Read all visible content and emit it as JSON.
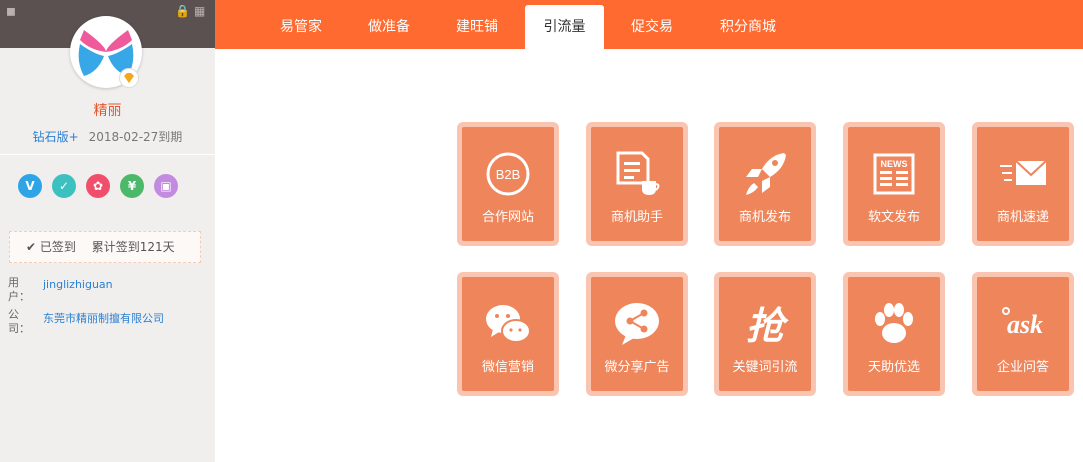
{
  "sidebar": {
    "username": "精丽",
    "vip_version": "钻石版+",
    "expiry": "2018-02-27到期",
    "services": [
      {
        "icon": "verified-v-icon",
        "glyph": "V",
        "color": "#2ea4e7"
      },
      {
        "icon": "shield-check-icon",
        "glyph": "✓",
        "color": "#3cc0c0"
      },
      {
        "icon": "award-ribbon-icon",
        "glyph": "✿",
        "color": "#f04e6b"
      },
      {
        "icon": "yuan-coin-icon",
        "glyph": "¥",
        "color": "#4cb86a"
      },
      {
        "icon": "image-icon",
        "glyph": "▣",
        "color": "#c38be0"
      }
    ],
    "checkin_status": "已签到",
    "checkin_total": "累计签到121天",
    "user_label": "用户：",
    "user_value": "jinglizhiguan",
    "company_label": "公司：",
    "company_value": "东莞市精丽制擅有限公司"
  },
  "nav": {
    "tabs": [
      "易管家",
      "做准备",
      "建旺铺",
      "引流量",
      "促交易",
      "积分商城"
    ],
    "active": "引流量"
  },
  "tiles": [
    {
      "label": "合作网站",
      "icon": "b2b-icon",
      "icon_text": "B2B"
    },
    {
      "label": "商机助手",
      "icon": "document-cup-icon"
    },
    {
      "label": "商机发布",
      "icon": "rocket-icon"
    },
    {
      "label": "软文发布",
      "icon": "newspaper-icon",
      "icon_text": "NEWS"
    },
    {
      "label": "商机速递",
      "icon": "fast-mail-icon"
    },
    {
      "label": "微信营销",
      "icon": "wechat-icon"
    },
    {
      "label": "微分享广告",
      "icon": "share-bubble-icon"
    },
    {
      "label": "关键词引流",
      "icon": "keyword-grab-icon",
      "icon_text": "抢"
    },
    {
      "label": "天助优选",
      "icon": "paw-icon"
    },
    {
      "label": "企业问答",
      "icon": "ask-icon",
      "icon_text": "ask"
    }
  ],
  "colors": {
    "header": "#ff6a30",
    "tile": "#ef855a",
    "tile_border": "#f9c4b0",
    "link": "#2a7fd3",
    "username": "#e4572e"
  }
}
